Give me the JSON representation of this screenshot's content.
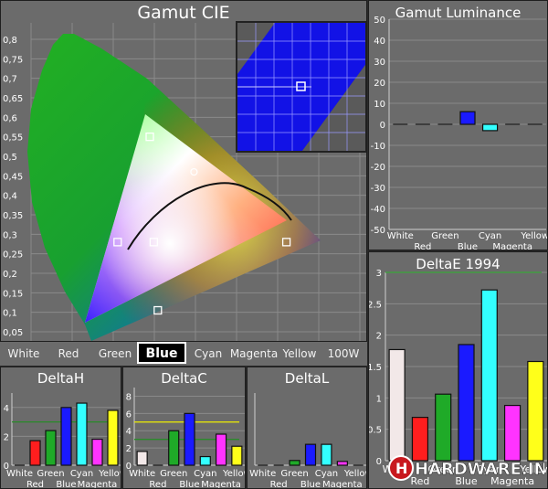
{
  "colors": {
    "white": "#f2e8e8",
    "red": "#ff1e1e",
    "green": "#1faa28",
    "blue": "#1a1aff",
    "cyan": "#33ffff",
    "magenta": "#ff33ff",
    "yellow": "#ffff1a",
    "panel": "#6b6b6b",
    "grid": "#8a8a8a",
    "target_line_green": "#2a8a2a",
    "target_line_yellow": "#eeee00"
  },
  "gamut_cie": {
    "title": "Gamut CIE",
    "y_ticks": [
      "0,8",
      "0,75",
      "0,7",
      "0,65",
      "0,6",
      "0,55",
      "0,5",
      "0,45",
      "0,4",
      "0,35",
      "0,3",
      "0,25",
      "0,2",
      "0,15",
      "0,1",
      "0,05"
    ],
    "measured_points": [
      {
        "name": "green",
        "x": 0.3,
        "y": 0.6
      },
      {
        "name": "yellow",
        "x": 0.41,
        "y": 0.51
      },
      {
        "name": "cyan",
        "x": 0.22,
        "y": 0.33
      },
      {
        "name": "white",
        "x": 0.31,
        "y": 0.33
      },
      {
        "name": "red",
        "x": 0.64,
        "y": 0.33
      },
      {
        "name": "magenta",
        "x": 0.32,
        "y": 0.155
      },
      {
        "name": "blue",
        "x": 0.15,
        "y": 0.06
      }
    ]
  },
  "tabs": [
    "White",
    "Red",
    "Green",
    "Blue",
    "Cyan",
    "Magenta",
    "Yellow",
    "100W"
  ],
  "active_tab": "Blue",
  "logo": {
    "text": "HARDWARE.INFO"
  },
  "chart_data": [
    {
      "type": "bar",
      "title": "Gamut Luminance",
      "categories": [
        "White",
        "Red",
        "Green",
        "Blue",
        "Cyan",
        "Magenta",
        "Yellow"
      ],
      "values": [
        0,
        0,
        0,
        6,
        -3,
        0,
        0
      ],
      "ylim": [
        -50,
        50
      ],
      "y_ticks": [
        50,
        40,
        30,
        20,
        10,
        0,
        -10,
        -20,
        -30,
        -40,
        -50
      ]
    },
    {
      "type": "bar",
      "title": "DeltaE 1994",
      "categories": [
        "White",
        "Red",
        "Green",
        "Blue",
        "Cyan",
        "Magenta",
        "Yellow"
      ],
      "values": [
        1.77,
        0.69,
        1.06,
        1.85,
        2.72,
        0.88,
        1.58
      ],
      "ylim": [
        0,
        3
      ],
      "y_ticks": [
        3,
        2.5,
        2,
        1.5,
        1,
        0.5,
        0
      ],
      "target_line": 3
    },
    {
      "type": "bar",
      "title": "DeltaH",
      "categories": [
        "White",
        "Red",
        "Green",
        "Blue",
        "Cyan",
        "Magenta",
        "Yellow"
      ],
      "values": [
        0,
        1.7,
        2.4,
        4.0,
        4.3,
        1.8,
        3.8
      ],
      "ylim": [
        0,
        5
      ],
      "y_ticks": [
        4,
        2,
        0
      ],
      "target_line": 3
    },
    {
      "type": "bar",
      "title": "DeltaC",
      "categories": [
        "White",
        "Red",
        "Green",
        "Blue",
        "Cyan",
        "Magenta",
        "Yellow"
      ],
      "values": [
        1.6,
        0,
        4.0,
        6.0,
        1.0,
        3.6,
        2.2
      ],
      "ylim": [
        0,
        9
      ],
      "y_ticks": [
        8,
        6,
        4,
        2,
        0
      ],
      "target_line": 5,
      "target_line_2": 3
    },
    {
      "type": "bar",
      "title": "DeltaL",
      "categories": [
        "White",
        "Red",
        "Green",
        "Blue",
        "Cyan",
        "Magenta",
        "Yellow"
      ],
      "values": [
        0,
        0,
        0.25,
        1.1,
        1.1,
        0.2,
        0
      ],
      "ylim": [
        0,
        3.8
      ],
      "y_ticks": []
    }
  ]
}
